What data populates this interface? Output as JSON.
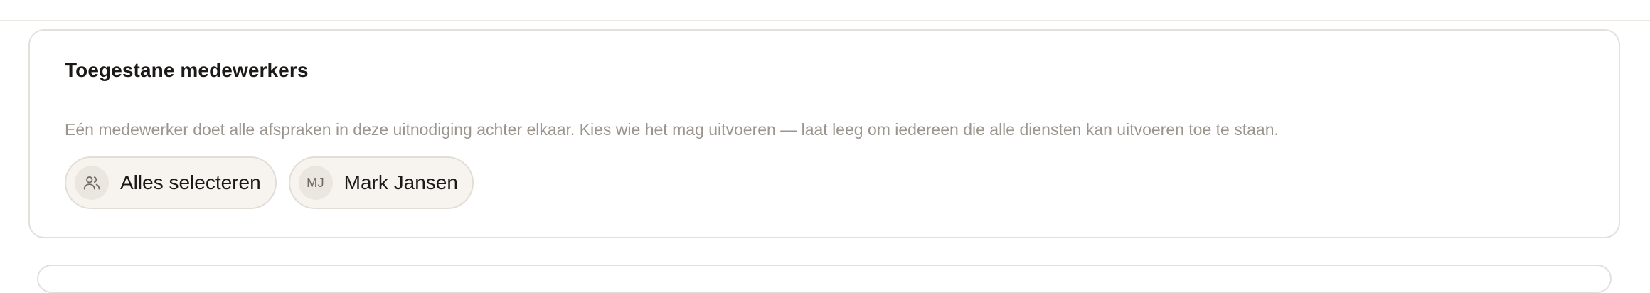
{
  "section": {
    "title": "Toegestane medewerkers",
    "description": "Eén medewerker doet alle afspraken in deze uitnodiging achter elkaar. Kies wie het mag uitvoeren — laat leeg om iedereen die alle diensten kan uitvoeren toe te staan.",
    "chips": [
      {
        "label": "Alles selecteren",
        "icon": "users-icon"
      },
      {
        "label": "Mark Jansen",
        "initials": "MJ"
      }
    ]
  }
}
